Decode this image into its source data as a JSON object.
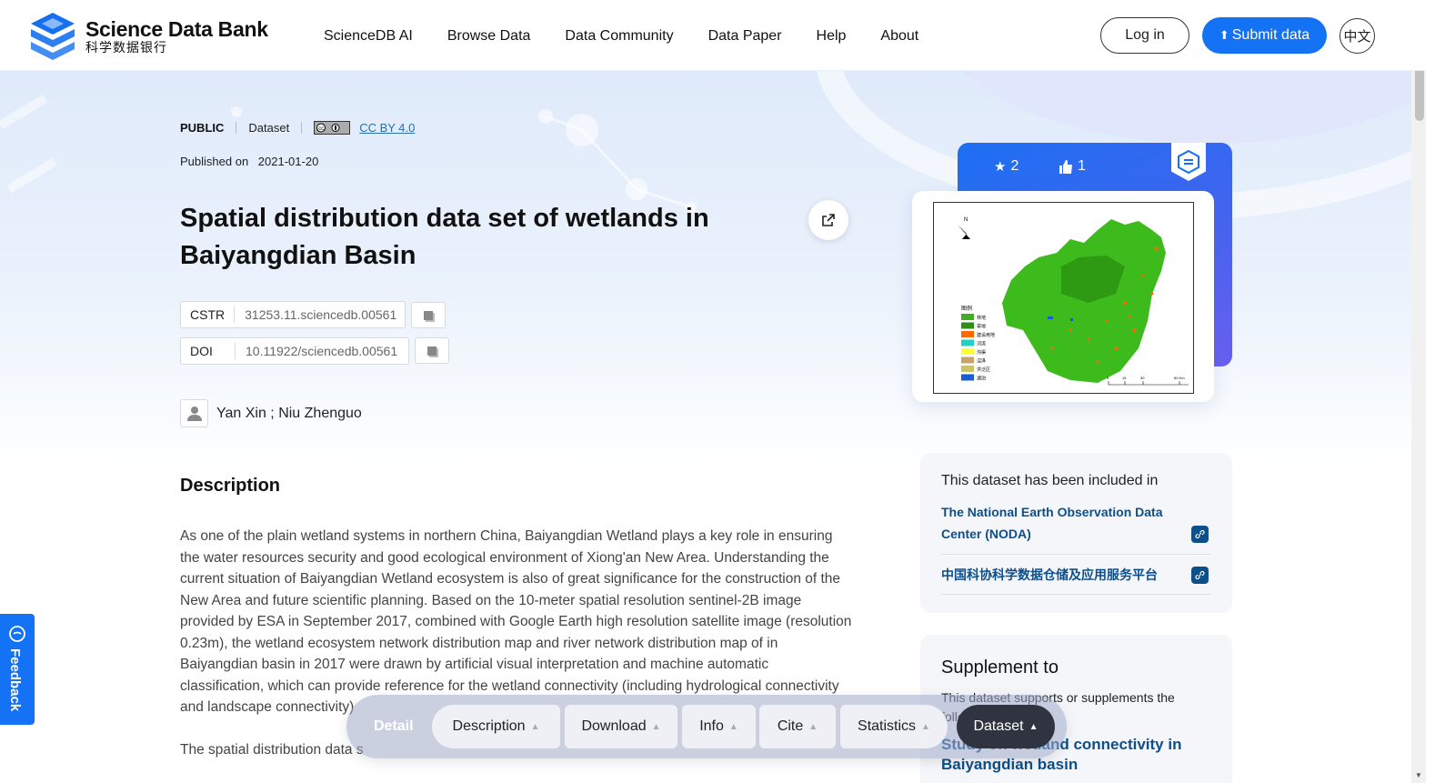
{
  "header": {
    "brand_en": "Science Data Bank",
    "brand_zh": "科学数据银行",
    "nav": [
      "ScienceDB AI",
      "Browse Data",
      "Data Community",
      "Data Paper",
      "Help",
      "About"
    ],
    "login_label": "Log in",
    "submit_label": "Submit data",
    "lang_label": "中文"
  },
  "meta": {
    "access": "PUBLIC",
    "type": "Dataset",
    "license": "CC BY 4.0",
    "published_label": "Published on",
    "published_date": "2021-01-20"
  },
  "title": "Spatial distribution data set of wetlands in Baiyangdian Basin",
  "identifiers": {
    "cstr_label": "CSTR",
    "cstr_value": "31253.11.sciencedb.00561",
    "doi_label": "DOI",
    "doi_value": "10.11922/sciencedb.00561"
  },
  "authors": "Yan Xin ; Niu Zhenguo",
  "description": {
    "heading": "Description",
    "paragraph1": "As one of the plain wetland systems in northern China, Baiyangdian Wetland plays a key role in ensuring the water resources security and good ecological environment of Xiong'an New Area. Understanding the current situation of Baiyangdian Wetland ecosystem is also of great significance for the construction of the New Area and future scientific planning. Based on the 10-meter spatial resolution sentinel-2B image provided by ESA in September 2017, combined with Google Earth high resolution satellite image (resolution 0.23m), the wetland ecosystem network distribution map and river network distribution map of in Baiyangdian basin in 2017 were drawn by artificial visual interpretation and machine automatic classification, which can provide reference for the wetland connectivity (including hydrological connectivity and landscape connectivity)",
    "paragraph2": "The spatial distribution data s"
  },
  "stats": {
    "favorites": "2",
    "likes": "1"
  },
  "map_legend": {
    "title": "图例",
    "items": [
      {
        "label": "林地",
        "color": "#3faf22"
      },
      {
        "label": "草地",
        "color": "#2f8f1a"
      },
      {
        "label": "建设用地",
        "color": "#ff6a00"
      },
      {
        "label": "河流",
        "color": "#20d0c0"
      },
      {
        "label": "沟渠",
        "color": "#ffff33"
      },
      {
        "label": "沼泽",
        "color": "#c8a46a"
      },
      {
        "label": "洪泛区",
        "color": "#c9c46a"
      },
      {
        "label": "湖泊",
        "color": "#1a5ad6"
      }
    ],
    "north": "N",
    "scale": [
      "0",
      "15",
      "30",
      "60 Km"
    ]
  },
  "included": {
    "heading": "This dataset has been included in",
    "links": [
      "The National Earth Observation Data Center (NODA)",
      "中国科协科学数据仓储及应用服务平台"
    ]
  },
  "supplement": {
    "heading": "Supplement to",
    "subtitle": "This dataset supports or supplements the following papers",
    "paper": "Study on wetland connectivity in Baiyangdian basin"
  },
  "feedback_label": "Feedback",
  "floatbar": {
    "detail_label": "Detail",
    "tabs": [
      "Description",
      "Download",
      "Info",
      "Cite",
      "Statistics",
      "Dataset"
    ]
  },
  "colors": {
    "primary": "#1472f5",
    "link": "#0d4f8a",
    "active_tab": "#2f3440"
  }
}
